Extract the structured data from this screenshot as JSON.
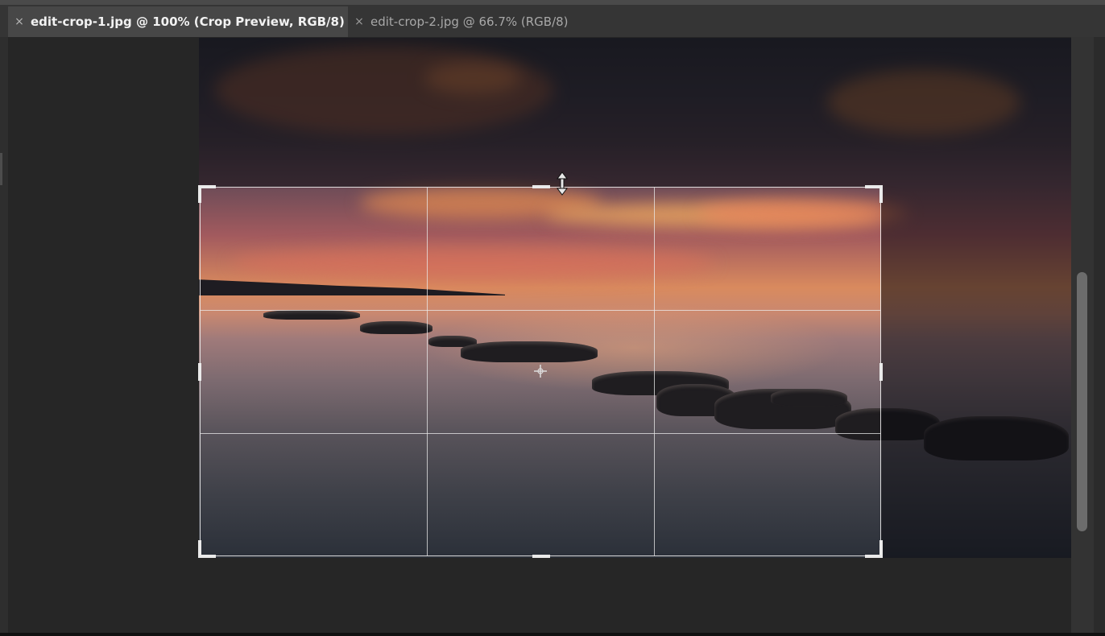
{
  "window": {
    "tabs": [
      {
        "label": "edit-crop-1.jpg @ 100% (Crop Preview, RGB/8)",
        "close": "×",
        "active": true
      },
      {
        "label": "edit-crop-2.jpg @ 66.7% (RGB/8)",
        "close": "×",
        "active": false
      }
    ]
  },
  "canvas": {
    "document": "edit-crop-1.jpg",
    "mode": "Crop Preview",
    "grid": "rule-of-thirds",
    "icons": [
      "resize-vertical-cursor-icon",
      "crop-center-icon"
    ]
  },
  "colors": {
    "accent": "#eaeaea",
    "workspace": "#262626",
    "tabbar": "#353535",
    "active_tab": "#474747"
  }
}
